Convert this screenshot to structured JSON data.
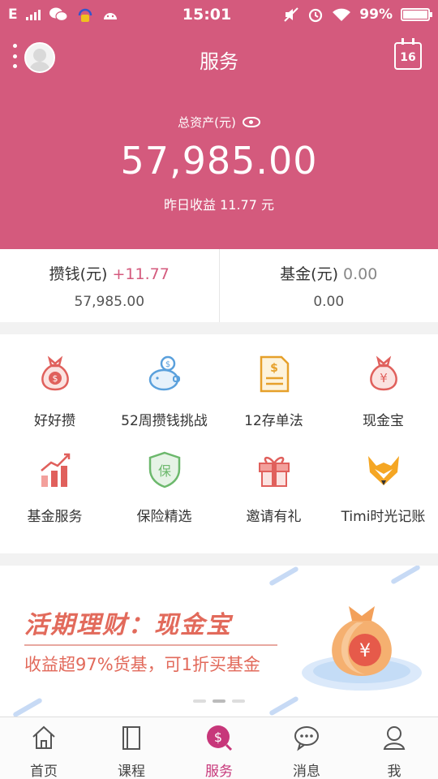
{
  "status_bar": {
    "network": "E",
    "time": "15:01",
    "battery": "99%"
  },
  "header": {
    "title": "服务",
    "calendar_day": "16",
    "assets_label": "总资产(元)",
    "assets_amount": "57,985.00",
    "yesterday_income": "昨日收益 11.77 元"
  },
  "balances": [
    {
      "label": "攒钱(元)",
      "change": "+11.77",
      "amount": "57,985.00"
    },
    {
      "label": "基金(元)",
      "change": "0.00",
      "amount": "0.00"
    }
  ],
  "services": [
    {
      "label": "好好攒",
      "icon": "money-bag-icon"
    },
    {
      "label": "52周攒钱挑战",
      "icon": "piggy-bank-icon"
    },
    {
      "label": "12存单法",
      "icon": "receipt-icon"
    },
    {
      "label": "现金宝",
      "icon": "yen-bag-icon"
    },
    {
      "label": "基金服务",
      "icon": "growth-chart-icon"
    },
    {
      "label": "保险精选",
      "icon": "insurance-shield-icon"
    },
    {
      "label": "邀请有礼",
      "icon": "gift-icon"
    },
    {
      "label": "Timi时光记账",
      "icon": "fox-icon"
    }
  ],
  "banner": {
    "title": "活期理财：现金宝",
    "subtitle": "收益超97%货基，可1折买基金"
  },
  "tabs": [
    {
      "label": "首页",
      "icon": "home-icon"
    },
    {
      "label": "课程",
      "icon": "book-icon"
    },
    {
      "label": "服务",
      "icon": "service-coin-icon",
      "active": true
    },
    {
      "label": "消息",
      "icon": "chat-icon"
    },
    {
      "label": "我",
      "icon": "person-icon"
    }
  ],
  "colors": {
    "brand": "#d45a7d",
    "service_icon_red": "#e0605c",
    "service_icon_blue": "#5aa0dc",
    "service_icon_orange": "#e6a02a",
    "active_tab": "#c7377a"
  }
}
